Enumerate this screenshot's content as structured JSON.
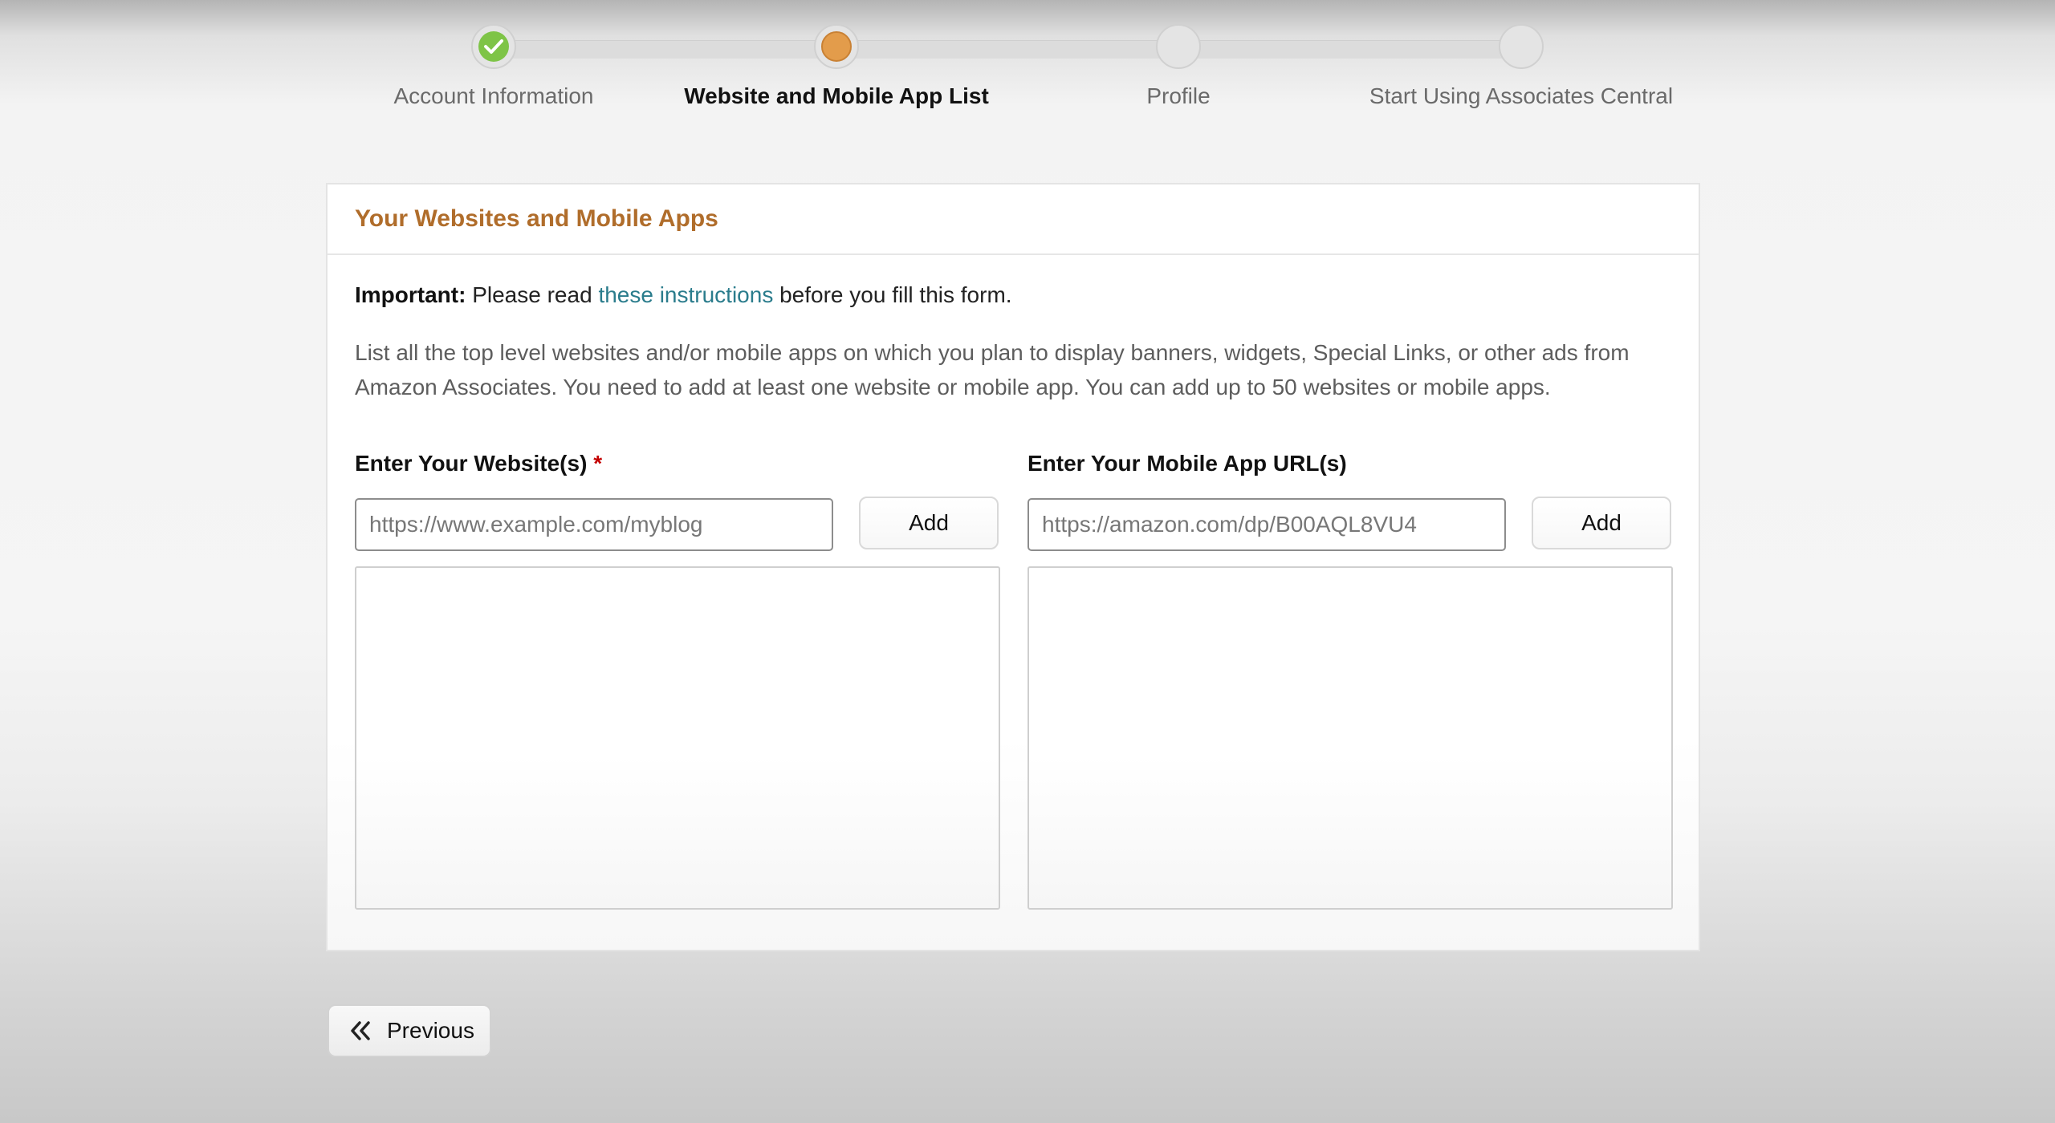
{
  "stepper": {
    "steps": [
      {
        "label": "Account Information",
        "state": "complete"
      },
      {
        "label": "Website and Mobile App List",
        "state": "current"
      },
      {
        "label": "Profile",
        "state": "pending"
      },
      {
        "label": "Start Using Associates Central",
        "state": "pending"
      }
    ]
  },
  "card": {
    "title": "Your Websites and Mobile Apps",
    "important_prefix": "Important:",
    "important_text_before": " Please read ",
    "important_link": "these instructions",
    "important_text_after": " before you fill this form.",
    "description": "List all the top level websites and/or mobile apps on which you plan to display banners, widgets, Special Links, or other ads from Amazon Associates. You need to add at least one website or mobile app. You can add up to 50 websites or mobile apps."
  },
  "websites": {
    "label": "Enter Your Website(s)",
    "required_marker": "*",
    "placeholder": "https://www.example.com/myblog",
    "value": "",
    "add_label": "Add",
    "items": []
  },
  "mobile_apps": {
    "label": "Enter Your Mobile App URL(s)",
    "placeholder": "https://amazon.com/dp/B00AQL8VU4",
    "value": "",
    "add_label": "Add",
    "items": []
  },
  "footer": {
    "previous_label": "Previous"
  },
  "colors": {
    "title_accent": "#b06d2b",
    "link": "#2a7c8c",
    "step_complete": "#7ec447",
    "step_current": "#e39c4b",
    "required": "#c40000"
  },
  "icons": {
    "step_complete": "checkmark-icon",
    "previous": "double-chevron-left-icon"
  }
}
